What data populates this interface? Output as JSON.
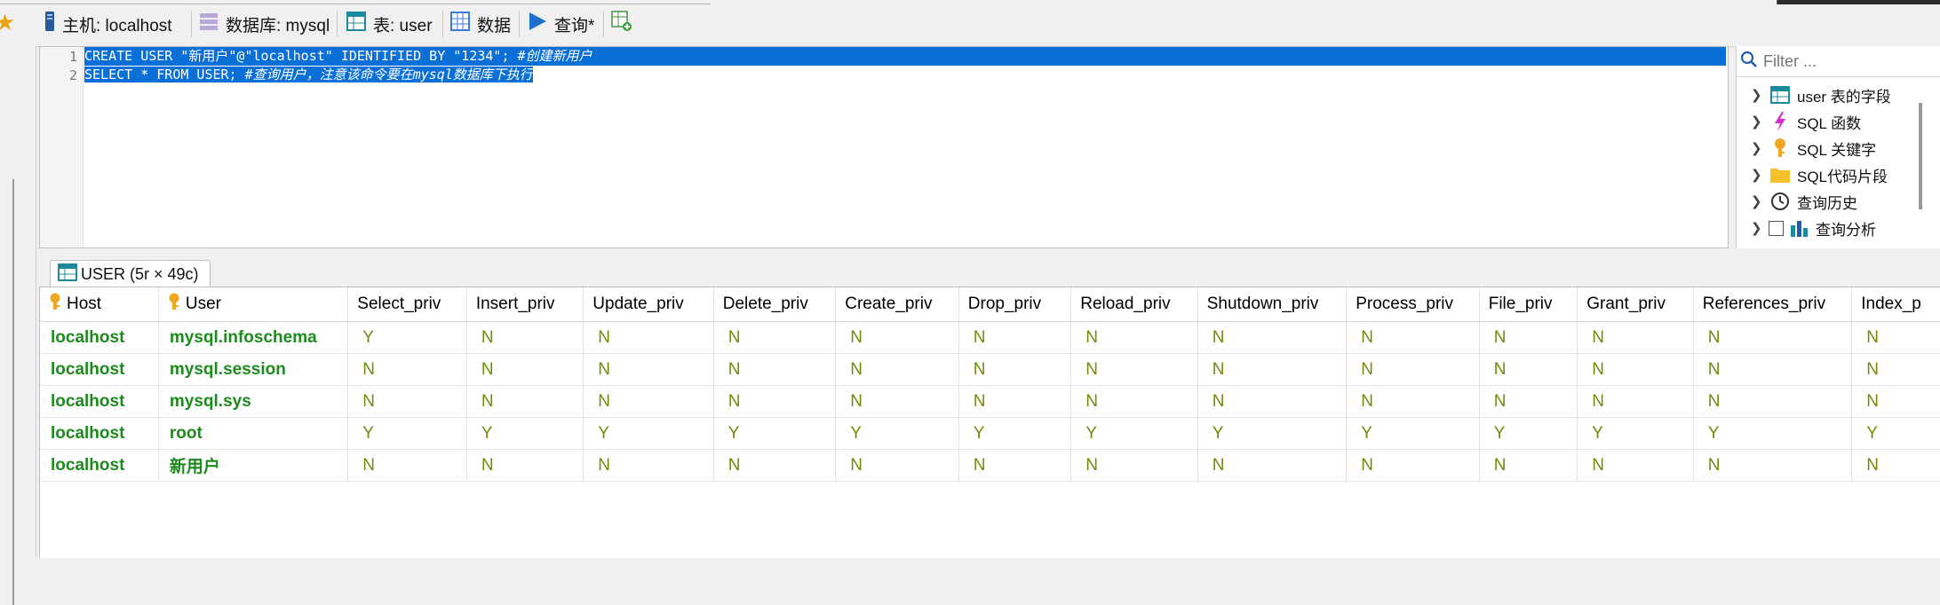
{
  "toolbar": {
    "host_label": "主机: localhost",
    "database_label": "数据库: mysql",
    "table_label": "表: user",
    "data_label": "数据",
    "query_label": "查询*"
  },
  "editor": {
    "lines": [
      {
        "number": "1",
        "code": "CREATE USER \"新用户\"@\"localhost\" IDENTIFIED BY \"1234\"; ",
        "comment": "#创建新用户"
      },
      {
        "number": "2",
        "code": "SELECT * FROM USER; ",
        "comment": "#查询用户，注意该命令要在mysql数据库下执行"
      }
    ]
  },
  "right_panel": {
    "filter_placeholder": "Filter ...",
    "items": [
      {
        "label": "user 表的字段",
        "icon": "table-icon"
      },
      {
        "label": "SQL 函数",
        "icon": "lightning-icon"
      },
      {
        "label": "SQL 关键字",
        "icon": "key-icon"
      },
      {
        "label": "SQL代码片段",
        "icon": "folder-icon"
      },
      {
        "label": "查询历史",
        "icon": "clock-icon"
      },
      {
        "label": "查询分析",
        "icon": "chart-icon"
      }
    ]
  },
  "result_tab": {
    "label": "USER (5r × 49c)"
  },
  "grid": {
    "columns": [
      "Host",
      "User",
      "Select_priv",
      "Insert_priv",
      "Update_priv",
      "Delete_priv",
      "Create_priv",
      "Drop_priv",
      "Reload_priv",
      "Shutdown_priv",
      "Process_priv",
      "File_priv",
      "Grant_priv",
      "References_priv",
      "Index_p"
    ],
    "rows": [
      [
        "localhost",
        "mysql.infoschema",
        "Y",
        "N",
        "N",
        "N",
        "N",
        "N",
        "N",
        "N",
        "N",
        "N",
        "N",
        "N",
        "N"
      ],
      [
        "localhost",
        "mysql.session",
        "N",
        "N",
        "N",
        "N",
        "N",
        "N",
        "N",
        "N",
        "N",
        "N",
        "N",
        "N",
        "N"
      ],
      [
        "localhost",
        "mysql.sys",
        "N",
        "N",
        "N",
        "N",
        "N",
        "N",
        "N",
        "N",
        "N",
        "N",
        "N",
        "N",
        "N"
      ],
      [
        "localhost",
        "root",
        "Y",
        "Y",
        "Y",
        "Y",
        "Y",
        "Y",
        "Y",
        "Y",
        "Y",
        "Y",
        "Y",
        "Y",
        "Y"
      ],
      [
        "localhost",
        "新用户",
        "N",
        "N",
        "N",
        "N",
        "N",
        "N",
        "N",
        "N",
        "N",
        "N",
        "N",
        "N",
        "N"
      ]
    ]
  },
  "colors": {
    "selection": "#0a6fd6",
    "key_text": "#1d8a1d",
    "value_text": "#6b8e0a"
  }
}
